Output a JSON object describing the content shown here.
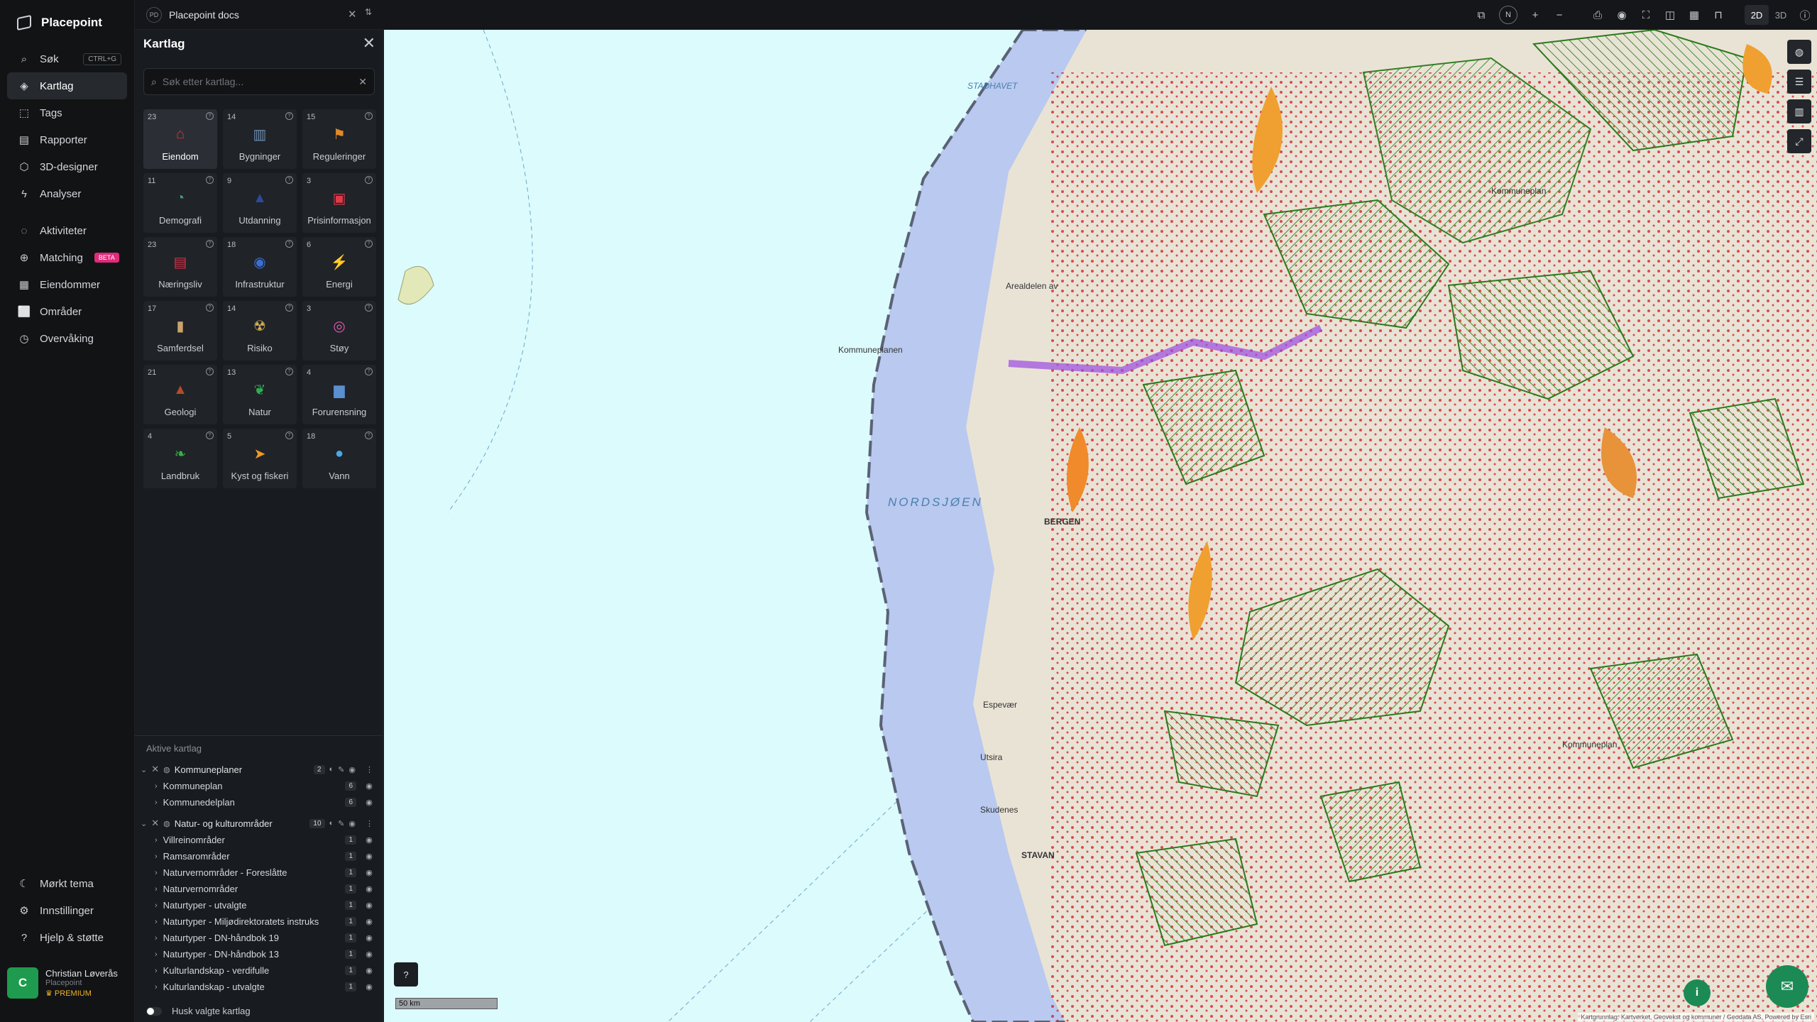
{
  "app": {
    "name": "Placepoint"
  },
  "nav": {
    "items": [
      {
        "label": "Søk",
        "shortcut": "CTRL+G",
        "icon": "search-icon"
      },
      {
        "label": "Kartlag",
        "icon": "layers-icon",
        "active": true
      },
      {
        "label": "Tags",
        "icon": "tag-icon"
      },
      {
        "label": "Rapporter",
        "icon": "chart-icon"
      },
      {
        "label": "3D-designer",
        "icon": "cube-icon"
      },
      {
        "label": "Analyser",
        "icon": "bolt-icon"
      }
    ],
    "items2": [
      {
        "label": "Aktiviteter",
        "icon": "chat-icon"
      },
      {
        "label": "Matching",
        "badge": "BETA",
        "icon": "match-icon"
      },
      {
        "label": "Eiendommer",
        "icon": "building-icon"
      },
      {
        "label": "Områder",
        "icon": "area-icon"
      },
      {
        "label": "Overvåking",
        "icon": "watch-icon"
      }
    ],
    "bottom": [
      {
        "label": "Mørkt tema",
        "icon": "moon-icon"
      },
      {
        "label": "Innstillinger",
        "icon": "gear-icon"
      },
      {
        "label": "Hjelp & støtte",
        "icon": "help-icon"
      }
    ],
    "user": {
      "initial": "C",
      "name": "Christian Løverås",
      "org": "Placepoint",
      "tier": "PREMIUM"
    }
  },
  "topbar": {
    "doc_badge": "PD",
    "doc_title": "Placepoint docs",
    "compass": "N",
    "mode_2d": "2D",
    "mode_3d": "3D"
  },
  "panel": {
    "title": "Kartlag",
    "search_placeholder": "Søk etter kartlag...",
    "tiles": [
      {
        "count": "23",
        "label": "Eiendom",
        "color": "#e0313a",
        "glyph": "⌂",
        "active": true
      },
      {
        "count": "14",
        "label": "Bygninger",
        "color": "#6f8fb3",
        "glyph": "▥"
      },
      {
        "count": "15",
        "label": "Reguleringer",
        "color": "#e08a2a",
        "glyph": "⚑"
      },
      {
        "count": "11",
        "label": "Demografi",
        "color": "#3aa56b",
        "glyph": "◔"
      },
      {
        "count": "9",
        "label": "Utdanning",
        "color": "#2a4a9a",
        "glyph": "▲"
      },
      {
        "count": "3",
        "label": "Prisinformasjon",
        "color": "#e03a4a",
        "glyph": "▣"
      },
      {
        "count": "23",
        "label": "Næringsliv",
        "color": "#d6304a",
        "glyph": "▤"
      },
      {
        "count": "18",
        "label": "Infrastruktur",
        "color": "#3a6fd6",
        "glyph": "◉"
      },
      {
        "count": "6",
        "label": "Energi",
        "color": "#f0c020",
        "glyph": "⚡"
      },
      {
        "count": "17",
        "label": "Samferdsel",
        "color": "#c9a36a",
        "glyph": "▮"
      },
      {
        "count": "14",
        "label": "Risiko",
        "color": "#d8b050",
        "glyph": "☢"
      },
      {
        "count": "3",
        "label": "Støy",
        "color": "#e05ab0",
        "glyph": "◎"
      },
      {
        "count": "21",
        "label": "Geologi",
        "color": "#b54a2a",
        "glyph": "▲"
      },
      {
        "count": "13",
        "label": "Natur",
        "color": "#2fae4e",
        "glyph": "❦"
      },
      {
        "count": "4",
        "label": "Forurensning",
        "color": "#5a8fd0",
        "glyph": "▆"
      },
      {
        "count": "4",
        "label": "Landbruk",
        "color": "#3aae4a",
        "glyph": "❧"
      },
      {
        "count": "5",
        "label": "Kyst og fiskeri",
        "color": "#f09a20",
        "glyph": "➤"
      },
      {
        "count": "18",
        "label": "Vann",
        "color": "#4aa8e8",
        "glyph": "●"
      }
    ],
    "active_title": "Aktive kartlag",
    "groups": [
      {
        "name": "Kommuneplaner",
        "count": "2",
        "rows": [
          {
            "name": "Kommuneplan",
            "n": "6"
          },
          {
            "name": "Kommunedelplan",
            "n": "6"
          }
        ]
      },
      {
        "name": "Natur- og kulturområder",
        "count": "10",
        "rows": [
          {
            "name": "Villreinområder",
            "n": "1"
          },
          {
            "name": "Ramsarområder",
            "n": "1"
          },
          {
            "name": "Naturvernområder - Foreslåtte",
            "n": "1"
          },
          {
            "name": "Naturvernområder",
            "n": "1"
          },
          {
            "name": "Naturtyper - utvalgte",
            "n": "1"
          },
          {
            "name": "Naturtyper - Miljødirektoratets instruks",
            "n": "1"
          },
          {
            "name": "Naturtyper - DN-håndbok 19",
            "n": "1"
          },
          {
            "name": "Naturtyper - DN-håndbok 13",
            "n": "1"
          },
          {
            "name": "Kulturlandskap - verdifulle",
            "n": "1"
          },
          {
            "name": "Kulturlandskap - utvalgte",
            "n": "1"
          }
        ]
      }
    ],
    "remember_label": "Husk valgte kartlag"
  },
  "map": {
    "sea_label": "NORDSJØEN",
    "labels": [
      "Kommuneplanen",
      "Kommuneplan",
      "Arealdelen av",
      "BERGEN",
      "STAVAN",
      "Kommuneplan",
      "STADHAVET",
      "Utsira",
      "Espevær",
      "Skudenes"
    ],
    "scale": "50 km",
    "attribution": "Kartgrunnlag: Kartverket, Geovekst og kommuner / Geodata AS, Powered by Esri"
  }
}
